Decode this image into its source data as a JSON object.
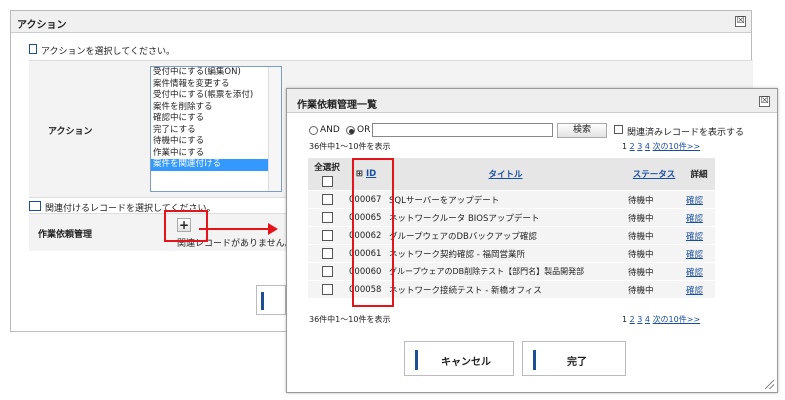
{
  "back_dialog": {
    "title": "アクション",
    "close": "☒",
    "select_prompt": "アクションを選択してください。",
    "action_label": "アクション",
    "action_options": [
      "受付中にする(編集ON)",
      "案件情報を変更する",
      "受付中にする(帳票を添付)",
      "案件を削除する",
      "確認中にする",
      "完了にする",
      "待機中にする",
      "作業中にする",
      "案件を関連付ける"
    ],
    "selected_option_index": 8,
    "link_prompt": "関連付けるレコードを選択してください。",
    "link_field_label": "作業依頼管理",
    "add_button": "+",
    "no_records": "関連レコードがありません。"
  },
  "front_dialog": {
    "title": "作業依頼管理一覧",
    "close": "☒",
    "and_label": "AND",
    "or_label": "OR",
    "search_mode": "OR",
    "search_value": "",
    "search_button": "検索",
    "show_related_label": "関連済みレコードを表示する",
    "count_text": "36件中1～10件を表示",
    "pager": [
      "1",
      "2",
      "3",
      "4"
    ],
    "pager_next": "次の10件>>",
    "columns": {
      "select_all": "全選択",
      "id": "ID",
      "title": "タイトル",
      "status": "ステータス",
      "detail": "詳細"
    },
    "rows": [
      {
        "id": "000067",
        "title": "SQLサーバーをアップデート",
        "status": "待機中",
        "detail": "確認"
      },
      {
        "id": "000065",
        "title": "ネットワークルータ BIOSアップデート",
        "status": "待機中",
        "detail": "確認"
      },
      {
        "id": "000062",
        "title": "グループウェアのDBバックアップ確認",
        "status": "待機中",
        "detail": "確認"
      },
      {
        "id": "000061",
        "title": "ネットワーク契約確認 - 福岡営業所",
        "status": "待機中",
        "detail": "確認"
      },
      {
        "id": "000060",
        "title": "グループウェアのDB削除テスト【部門名】製品開発部",
        "status": "待機中",
        "detail": "確認"
      },
      {
        "id": "000058",
        "title": "ネットワーク接続テスト - 新橋オフィス",
        "status": "待機中",
        "detail": "確認"
      }
    ],
    "cancel_button": "キャンセル",
    "done_button": "完了"
  },
  "colors": {
    "highlight": "#e4141b",
    "link": "#1a4fa0",
    "selected": "#3399ff",
    "button_bar": "#1d4f91"
  }
}
